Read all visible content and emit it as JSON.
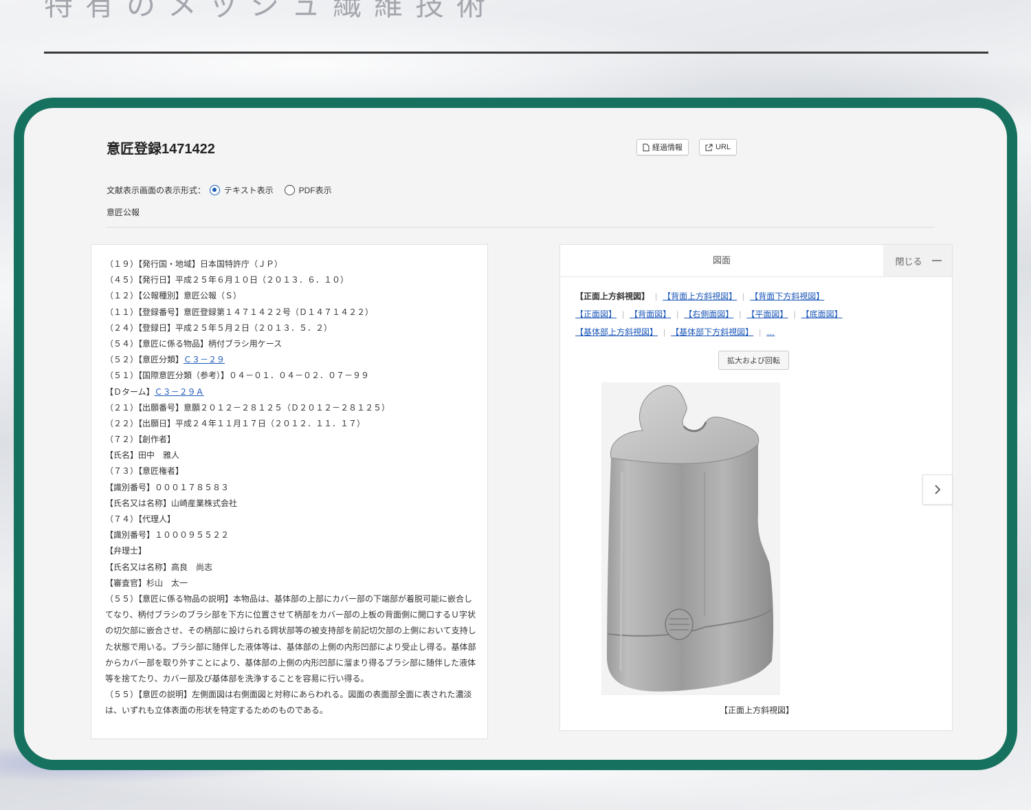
{
  "hero": {
    "title": "特有のメッシュ繊維技術"
  },
  "document": {
    "title": "意匠登録1471422",
    "buttons": {
      "history": "経過情報",
      "url": "URL"
    },
    "format_label": "文献表示画面の表示形式：",
    "format_options": {
      "text": "テキスト表示",
      "pdf": "PDF表示"
    },
    "selected_format": "テキスト表示",
    "kind": "意匠公報"
  },
  "text_panel": {
    "lines": [
      "（１９）【発行国・地域】日本国特許庁（ＪＰ）",
      "（４５）【発行日】平成２５年６月１０日（２０１３．６．１０）",
      "（１２）【公報種別】意匠公報（Ｓ）",
      "（１１）【登録番号】意匠登録第１４７１４２２号（Ｄ１４７１４２２）",
      "（２４）【登録日】平成２５年５月２日（２０１３．５．２）",
      "（５４）【意匠に係る物品】柄付ブラシ用ケース"
    ],
    "class_label": "（５２）【意匠分類】",
    "class_link": "Ｃ３－２９",
    "intl_class": "（５１）【国際意匠分類（参考）】０４－０１．０４－０２．０７－９９",
    "dterm_label": "【Ｄターム】",
    "dterm_link": "Ｃ３－２９Ａ",
    "lines2": [
      "（２１）【出願番号】意願２０１２－２８１２５（Ｄ２０１２－２８１２５）",
      "（２２）【出願日】平成２４年１１月１７日（２０１２．１１．１７）",
      "（７２）【創作者】",
      "【氏名】田中　雅人",
      "（７３）【意匠権者】",
      "【識別番号】０００１７８５８３",
      "【氏名又は名称】山崎産業株式会社",
      "（７４）【代理人】",
      "【識別番号】１０００９５５２２",
      "【弁理士】",
      "【氏名又は名称】高良　尚志",
      "【審査官】杉山　太一"
    ],
    "para1": "（５５）【意匠に係る物品の説明】本物品は、基体部の上部にカバー部の下端部が着脱可能に嵌合してなり、柄付ブラシのブラシ部を下方に位置させて柄部をカバー部の上板の背面側に開口するＵ字状の切欠部に嵌合させ、その柄部に設けられる鍔状部等の被支持部を前記切欠部の上側において支持した状態で用いる。ブラシ部に随伴した液体等は、基体部の上側の内形凹部により受止し得る。基体部からカバー部を取り外すことにより、基体部の上側の内形凹部に溜まり得るブラシ部に随伴した液体等を捨てたり、カバー部及び基体部を洗浄することを容易に行い得る。",
    "para2": "（５５）【意匠の説明】左側面図は右側面図と対称にあらわれる。図面の表面部全面に表された濃淡は、いずれも立体表面の形状を特定するためのものである。"
  },
  "figure_panel": {
    "header": "図面",
    "close": "閉じる",
    "views": {
      "current": "【正面上方斜視図】",
      "links": [
        "【背面上方斜視図】",
        "【背面下方斜視図】",
        "【正面図】",
        "【背面図】",
        "【右側面図】",
        "【平面図】",
        "【底面図】",
        "【基体部上方斜視図】",
        "【基体部下方斜視図】",
        "…"
      ]
    },
    "zoom_button": "拡大および回転",
    "caption": "【正面上方斜視図】"
  },
  "colors": {
    "frame": "#17715f",
    "link": "#1a56b8"
  }
}
